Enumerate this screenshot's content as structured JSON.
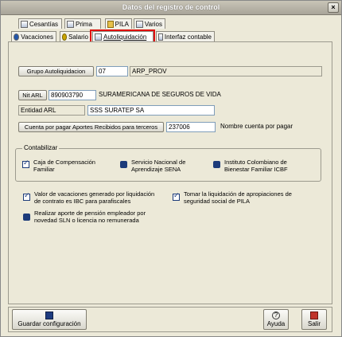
{
  "window": {
    "title": "Datos del registro de control",
    "close_symbol": "×"
  },
  "tabs_row1": [
    {
      "label": "Cesantías"
    },
    {
      "label": "Prima"
    },
    {
      "label": "PILA"
    },
    {
      "label": "Varios"
    }
  ],
  "tabs_row2": [
    {
      "label": "Vacaciones"
    },
    {
      "label": "Salario"
    },
    {
      "label": "Autoliquidación"
    },
    {
      "label": "Interfaz contable"
    }
  ],
  "grupo": {
    "button": "Grupo Autoliquidacion",
    "code": "07",
    "name": "ARP_PROV"
  },
  "nit": {
    "button": "Nit ARL",
    "value": "890903790",
    "name": "SURAMERICANA DE SEGUROS DE VIDA"
  },
  "entidad": {
    "label": "Entidad ARL",
    "value": "SSS SURATEP SA"
  },
  "cuenta": {
    "button": "Cuenta por pagar Aportes Recibidos para terceros",
    "value": "237006",
    "label": "Nombre cuenta por pagar"
  },
  "contabilizar": {
    "title": "Contabilizar",
    "items": [
      {
        "label": "Caja de Compensación Familiar",
        "checked": true
      },
      {
        "label": "Servicio Nacional de Aprendizaje SENA",
        "checked": false
      },
      {
        "label": "Instituto Colombiano de Bienestar Familiar ICBF",
        "checked": false
      }
    ]
  },
  "options": {
    "vacaciones": "Valor de vacaciones generado por liquidación de contrato es IBC para parafiscales",
    "pila": "Tomar la liquidación de apropiaciones de seguridad social de PILA",
    "sln": "Realizar aporte de pensión empleador por novedad SLN o licencia no remunerada"
  },
  "footer": {
    "save": "Guardar configuración",
    "help": "Ayuda",
    "exit": "Salir",
    "help_symbol": "?"
  }
}
